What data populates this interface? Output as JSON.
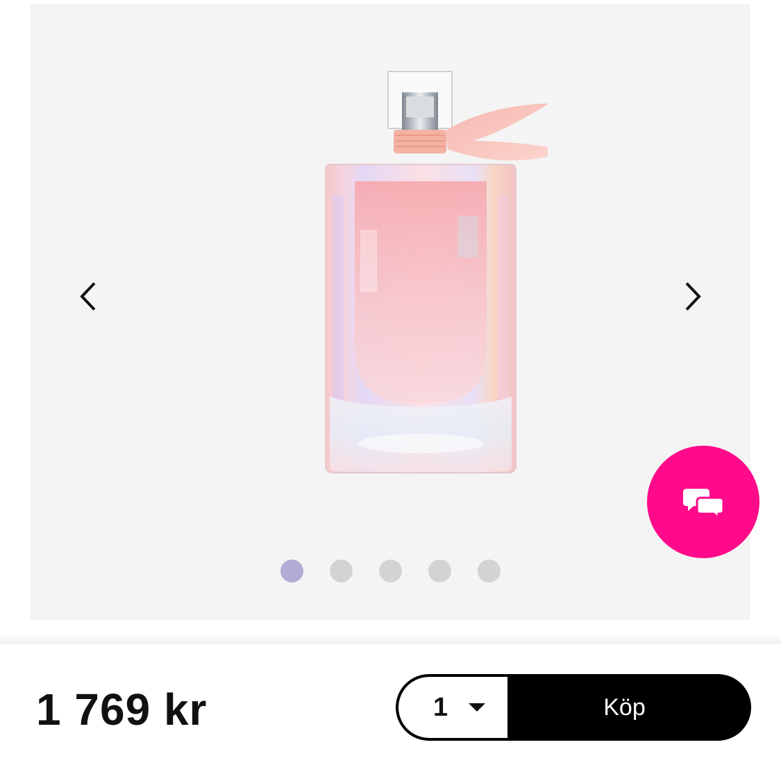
{
  "gallery": {
    "image_subject": "perfume-bottle",
    "prev_icon": "chevron-left-icon",
    "next_icon": "chevron-right-icon",
    "dots_count": 5,
    "active_dot_index": 0,
    "colors": {
      "background": "#f4f4f4",
      "dot_active": "#b3abd6",
      "dot_inactive": "#d3d3d3"
    }
  },
  "chat": {
    "icon": "chat-bubbles-icon",
    "color": "#ff0a8a"
  },
  "purchase": {
    "price": "1 769 kr",
    "quantity": "1",
    "quantity_icon": "caret-down-icon",
    "buy_label": "Köp"
  }
}
